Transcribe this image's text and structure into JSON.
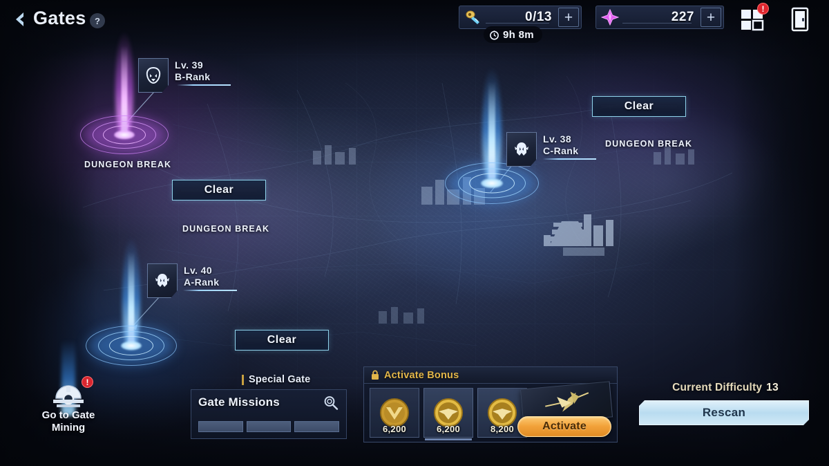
{
  "header": {
    "back_icon": "chevron-left-icon",
    "title": "Gates",
    "help_label": "?"
  },
  "resources": [
    {
      "id": "key",
      "icon": "gate-key-icon",
      "value": "0/13",
      "plus_label": "+"
    },
    {
      "id": "crystal",
      "icon": "crystal-icon",
      "value": "227",
      "plus_label": "+"
    }
  ],
  "timer": {
    "icon": "clock-icon",
    "text": "9h 8m"
  },
  "top_icons": {
    "grid": {
      "icon": "grid-menu-icon",
      "badge": "!"
    },
    "exit": {
      "icon": "exit-door-icon"
    }
  },
  "gates": [
    {
      "id": "gate-b",
      "level": "Lv. 39",
      "rank": "B-Rank",
      "color": "#c05cf0",
      "emblem": "beast-emblem-icon",
      "dungeon_break_label": "DUNGEON BREAK",
      "clear_label": "Clear"
    },
    {
      "id": "gate-a",
      "level": "Lv. 40",
      "rank": "A-Rank",
      "color": "#4aa8ff",
      "emblem": "demon-emblem-icon",
      "clear_label": "Clear"
    },
    {
      "id": "gate-c",
      "level": "Lv. 38",
      "rank": "C-Rank",
      "color": "#4aa8ff",
      "emblem": "demon-emblem-icon",
      "dungeon_break_label": "DUNGEON BREAK",
      "clear_label": "Clear"
    }
  ],
  "map_labels": {
    "dungeon_break_left": "DUNGEON BREAK",
    "dungeon_break_mid": "DUNGEON BREAK",
    "dungeon_break_right": "DUNGEON BREAK",
    "clear_left": "Clear",
    "clear_mid": "Clear",
    "clear_right": "Clear"
  },
  "mining": {
    "icon": "gate-mining-icon",
    "label": "Go to Gate\nMining",
    "label_line1": "Go to Gate",
    "label_line2": "Mining",
    "alert": "!"
  },
  "special_gate": {
    "header": "Special Gate",
    "missions_title": "Gate Missions",
    "search_icon": "magnifier-icon",
    "slots": [
      "",
      "",
      ""
    ]
  },
  "activate_bonus": {
    "lock_icon": "lock-icon",
    "title": "Activate Bonus",
    "rewards": [
      {
        "icon": "gold-coin-check-icon",
        "amount": "6,200",
        "selected": true
      },
      {
        "icon": "gold-coin-icon",
        "amount": "6,200",
        "selected": false
      },
      {
        "icon": "gold-coin-icon",
        "amount": "8,200",
        "selected": false
      }
    ],
    "card_icon": "weapon-card-icon",
    "activate_label": "Activate"
  },
  "difficulty": {
    "label": "Current Difficulty",
    "value": "13",
    "rescan_label": "Rescan"
  },
  "colors": {
    "accent_blue": "#8fd2ea",
    "accent_purple": "#c05cf0",
    "accent_gold": "#e2b64a",
    "alert_red": "#d9262f",
    "activate_orange": "#f2a23a"
  }
}
